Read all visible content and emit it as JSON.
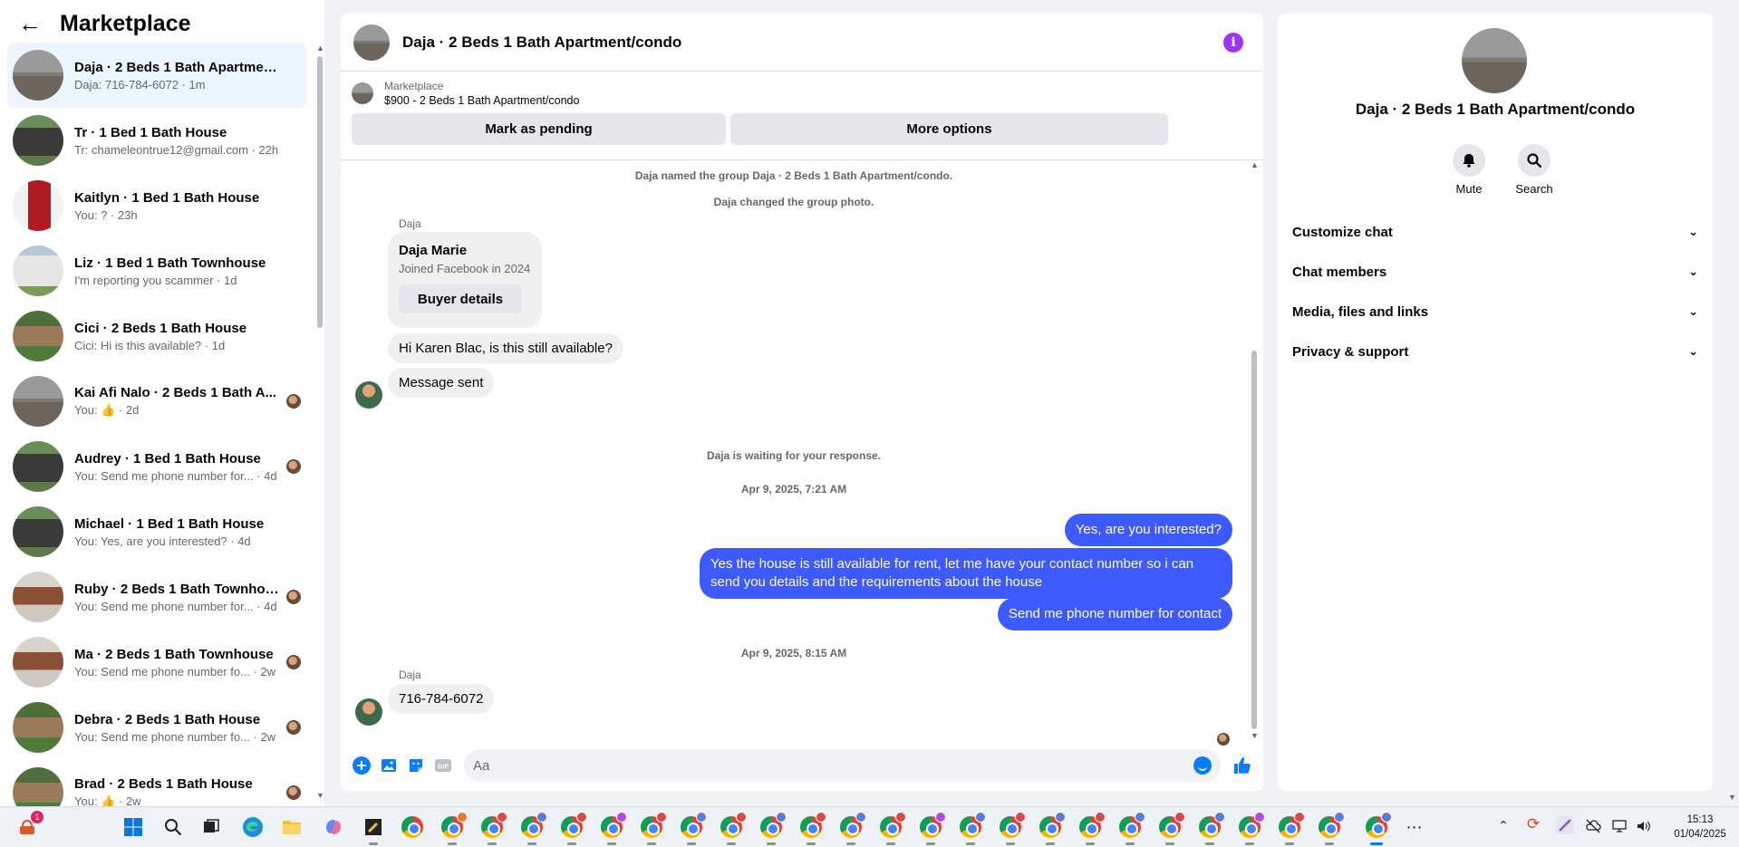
{
  "sidebar": {
    "title": "Marketplace",
    "conversations": [
      {
        "title": "Daja · 2 Beds 1 Bath Apartment/...",
        "snippet": "Daja: 716-784-6072 · 1m",
        "active": true,
        "thumb": "img-floor",
        "seen": false
      },
      {
        "title": "Tr · 1 Bed 1 Bath House",
        "snippet": "Tr: chameleontrue12@gmail.com · 22h",
        "thumb": "img-house-dark",
        "seen": false
      },
      {
        "title": "Kaitlyn · 1 Bed 1 Bath House",
        "snippet": "You: ? · 23h",
        "thumb": "img-red",
        "seen": false
      },
      {
        "title": "Liz · 1 Bed 1 Bath Townhouse",
        "snippet": "I'm reporting you scammer · 1d",
        "thumb": "img-white-house",
        "seen": false
      },
      {
        "title": "Cici · 2 Beds 1 Bath House",
        "snippet": "Cici: Hi is this available? · 1d",
        "thumb": "img-green-house",
        "seen": false
      },
      {
        "title": "Kai Afi Nalo · 2 Beds 1 Bath A...",
        "snippet": "You: 👍 · 2d",
        "thumb": "img-floor",
        "seen": true
      },
      {
        "title": "Audrey · 1 Bed 1 Bath House",
        "snippet": "You: Send me phone number for... · 4d",
        "thumb": "img-house-dark",
        "seen": true
      },
      {
        "title": "Michael · 1 Bed 1 Bath House",
        "snippet": "You: Yes, are you interested? · 4d",
        "thumb": "img-house-dark",
        "seen": false
      },
      {
        "title": "Ruby · 2 Beds 1 Bath Townhou...",
        "snippet": "You: Send me phone number for... · 4d",
        "thumb": "img-kitchen",
        "seen": true
      },
      {
        "title": "Ma · 2 Beds 1 Bath Townhouse",
        "snippet": "You: Send me phone number fo... · 2w",
        "thumb": "img-kitchen",
        "seen": true
      },
      {
        "title": "Debra · 2 Beds 1 Bath House",
        "snippet": "You: Send me phone number fo... · 2w",
        "thumb": "img-green-house",
        "seen": true
      },
      {
        "title": "Brad · 2 Beds 1 Bath House",
        "snippet": "You: 👍 · 2w",
        "thumb": "img-green-house",
        "seen": true
      }
    ]
  },
  "chat": {
    "title": "Daja · 2 Beds 1 Bath Apartment/condo",
    "listing": {
      "label": "Marketplace",
      "price_title": "$900 - 2 Beds 1 Bath Apartment/condo",
      "mark_pending": "Mark as pending",
      "more_options": "More options"
    },
    "system": {
      "named_group": "Daja named the group Daja · 2 Beds 1 Bath Apartment/condo.",
      "changed_photo": "Daja changed the group photo.",
      "waiting": "Daja is waiting for your response.",
      "time1": "Apr 9, 2025, 7:21 AM",
      "time2": "Apr 9, 2025, 8:15 AM"
    },
    "sender": "Daja",
    "card": {
      "name": "Daja Marie",
      "joined": "Joined Facebook in 2024",
      "button": "Buyer details"
    },
    "incoming": {
      "m1": "Hi Karen Blac, is this still available?",
      "m2": "Message sent",
      "m3": "716-784-6072"
    },
    "outgoing": {
      "m1": "Yes, are you interested?",
      "m2": "Yes the house is still available for rent, let me have your contact number so i can send you details and the requirements about the house",
      "m3": "Send me phone number for contact"
    },
    "composer": {
      "placeholder": "Aa"
    }
  },
  "details": {
    "name": "Daja · 2 Beds 1 Bath Apartment/condo",
    "mute": "Mute",
    "search": "Search",
    "sections": [
      "Customize chat",
      "Chat members",
      "Media, files and links",
      "Privacy & support"
    ]
  },
  "taskbar": {
    "notification_count": "1",
    "time": "15:13",
    "date": "01/04/2025"
  },
  "colors": {
    "accent": "#3d5afe",
    "info": "#a033f0",
    "like": "#0a7cff"
  }
}
